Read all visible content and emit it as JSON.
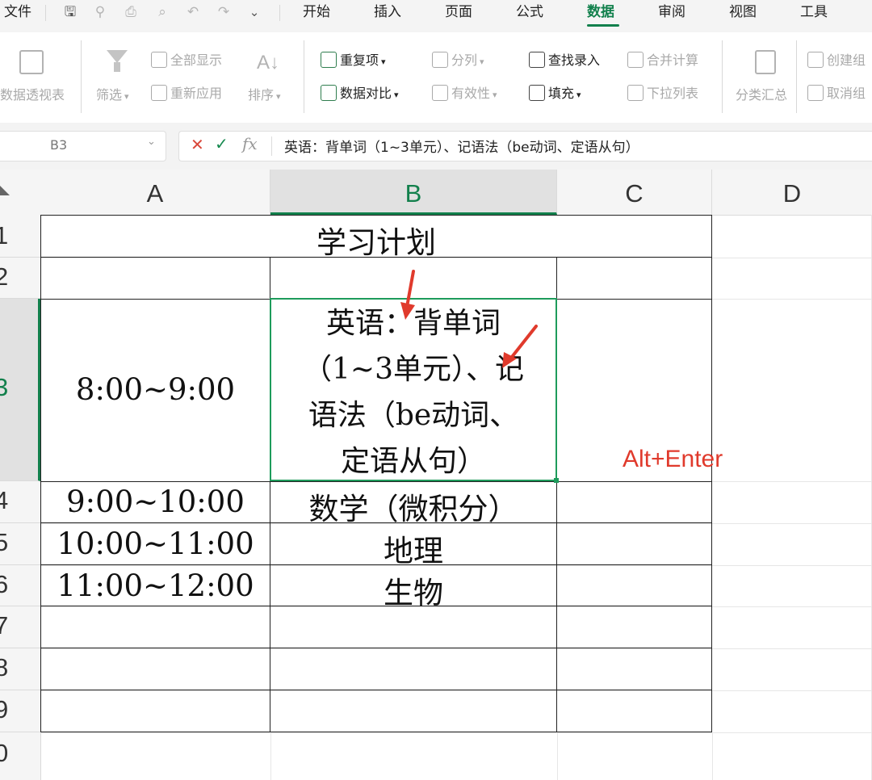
{
  "menu": {
    "file": "文件",
    "tabs": [
      "开始",
      "插入",
      "页面",
      "公式",
      "数据",
      "审阅",
      "视图",
      "工具"
    ],
    "active_tab": "数据",
    "accent_color": "#12804c"
  },
  "ribbon": {
    "pivot": "数据透视表",
    "filter": "筛选",
    "show_all": "全部显示",
    "reapply": "重新应用",
    "sort": "排序",
    "duplicates": "重复项",
    "compare": "数据对比",
    "split": "分列",
    "validity": "有效性",
    "lookup_entry": "查找录入",
    "fill": "填充",
    "consolidate": "合并计算",
    "dropdown": "下拉列表",
    "subtotal": "分类汇总",
    "group": "创建组",
    "ungroup": "取消组"
  },
  "formula_bar": {
    "name_box": "B3",
    "cancel_icon": "close-icon",
    "confirm_icon": "check-icon",
    "fx": "fx",
    "content": "英语：背单词（1~3单元）、记语法（be动词、定语从句）"
  },
  "grid": {
    "columns": [
      "A",
      "B",
      "C",
      "D"
    ],
    "selected_column": "B",
    "rows": [
      "1",
      "2",
      "3",
      "4",
      "5",
      "6",
      "7",
      "8",
      "9",
      "0"
    ],
    "selected_row": "3",
    "selection_color": "#1e9b5b"
  },
  "cells": {
    "title": "学习计划",
    "a3": "8:00~9:00",
    "a4": "9:00~10:00",
    "a5": "10:00~11:00",
    "a6": "11:00~12:00",
    "b3_lines": [
      "英语：背单词",
      "（1~3单元）、记",
      "语法（be动词、",
      "定语从句）"
    ],
    "b4": "数学（微积分）",
    "b5": "地理",
    "b6": "生物"
  },
  "annotation": {
    "shortcut_hint": "Alt+Enter",
    "color": "#e03a2c"
  }
}
